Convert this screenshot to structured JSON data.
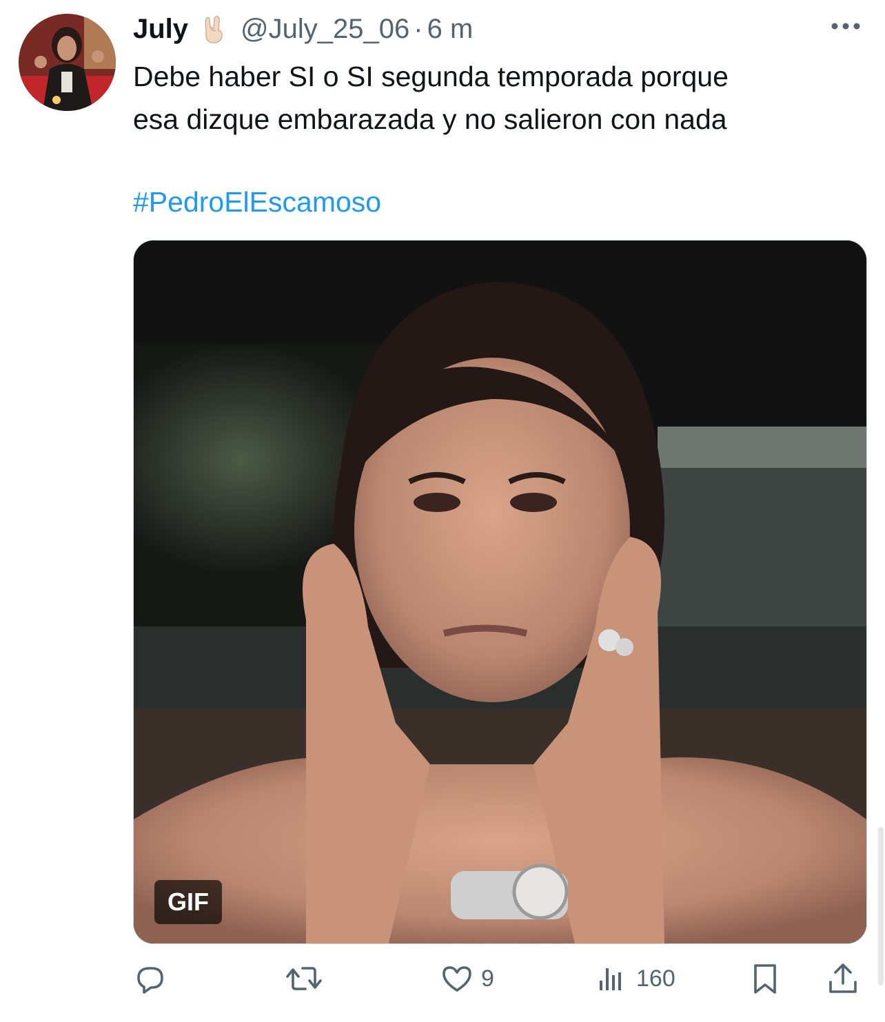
{
  "tweet": {
    "author": {
      "display_name": "July",
      "badge_emoji": "🤘🏻",
      "handle": "@July_25_06",
      "separator": "·",
      "time_ago": "6 m"
    },
    "text": "Debe haber SI o SI segunda temporada porque\nesa dizque embarazada y no salieron con nada",
    "hashtag": "#PedroElEscamoso",
    "media": {
      "type_label": "GIF"
    },
    "actions": {
      "reply": {
        "icon": "reply-icon",
        "count": ""
      },
      "retweet": {
        "icon": "retweet-icon",
        "count": ""
      },
      "like": {
        "icon": "heart-icon",
        "count": "9"
      },
      "views": {
        "icon": "views-chart-icon",
        "count": "160"
      },
      "bookmark": {
        "icon": "bookmark-icon"
      },
      "share": {
        "icon": "share-icon"
      }
    }
  },
  "colors": {
    "link": "#1d9bf0",
    "secondary_text": "#536471",
    "primary_text": "#0f1419"
  }
}
